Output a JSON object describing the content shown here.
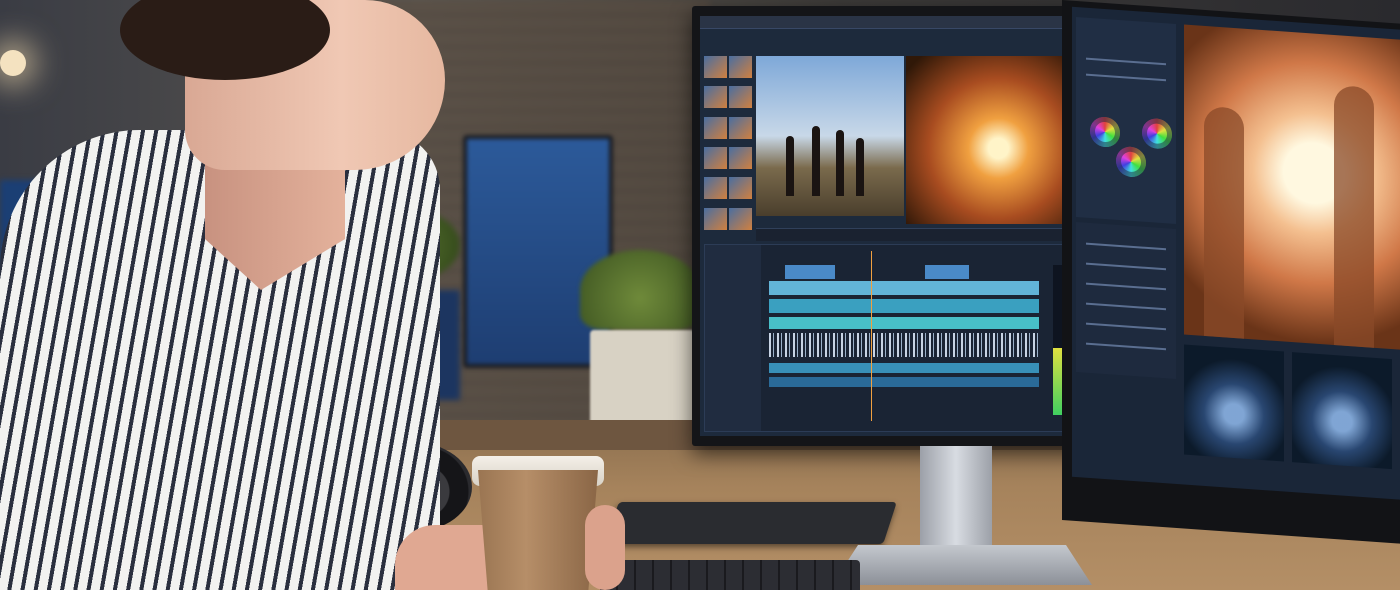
{
  "scene": {
    "subject": "woman-at-video-editing-workstation",
    "colors": {
      "accent": "#f0a040",
      "screen": "#1d2a3c",
      "shirt_stripe": "#2a2f3e"
    }
  },
  "editor": {
    "audio_level": 0.45
  }
}
